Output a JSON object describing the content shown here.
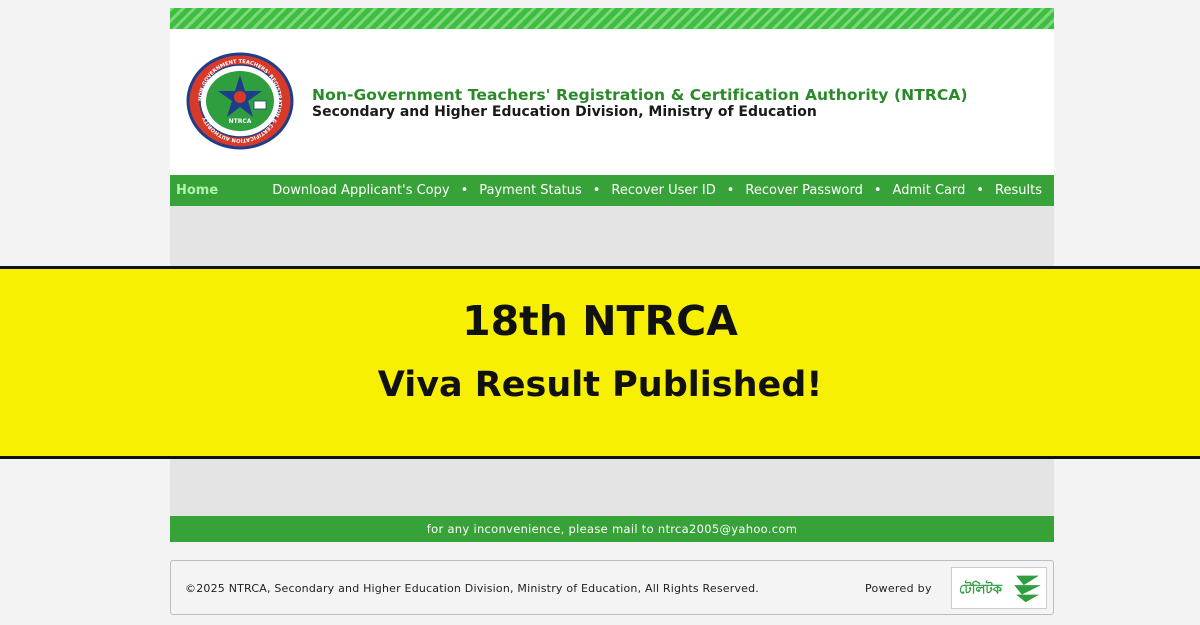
{
  "header": {
    "title": "Non-Government Teachers' Registration & Certification Authority (NTRCA)",
    "subtitle": "Secondary and Higher Education Division, Ministry of Education",
    "logo_text": "NTRCA",
    "logo_ring_text": "NON-GOVERNMENT TEACHERS' REGISTRATION & CERTIFICATION AUTHORITY"
  },
  "nav": {
    "home": "Home",
    "items": [
      {
        "label": "Download Applicant's Copy"
      },
      {
        "label": "Payment Status"
      },
      {
        "label": "Recover User ID"
      },
      {
        "label": "Recover Password"
      },
      {
        "label": "Admit Card"
      },
      {
        "label": "Results"
      }
    ],
    "separator": "•"
  },
  "mail_bar": {
    "text": "for any inconvenience, please mail to ntrca2005@yahoo.com"
  },
  "footer": {
    "copyright": "©2025 NTRCA, Secondary and Higher Education Division, Ministry of Education, All Rights Reserved.",
    "powered_by": "Powered by",
    "partner_logo_text": "টেলিটক"
  },
  "banner": {
    "line1": "18th NTRCA",
    "line2": "Viva Result Published!"
  },
  "colors": {
    "brand_green": "#37a237",
    "stripe_green": "#3cbf3c",
    "banner_yellow": "#f7f002",
    "logo_red": "#d83a2a",
    "logo_navy": "#1f3d8a"
  }
}
